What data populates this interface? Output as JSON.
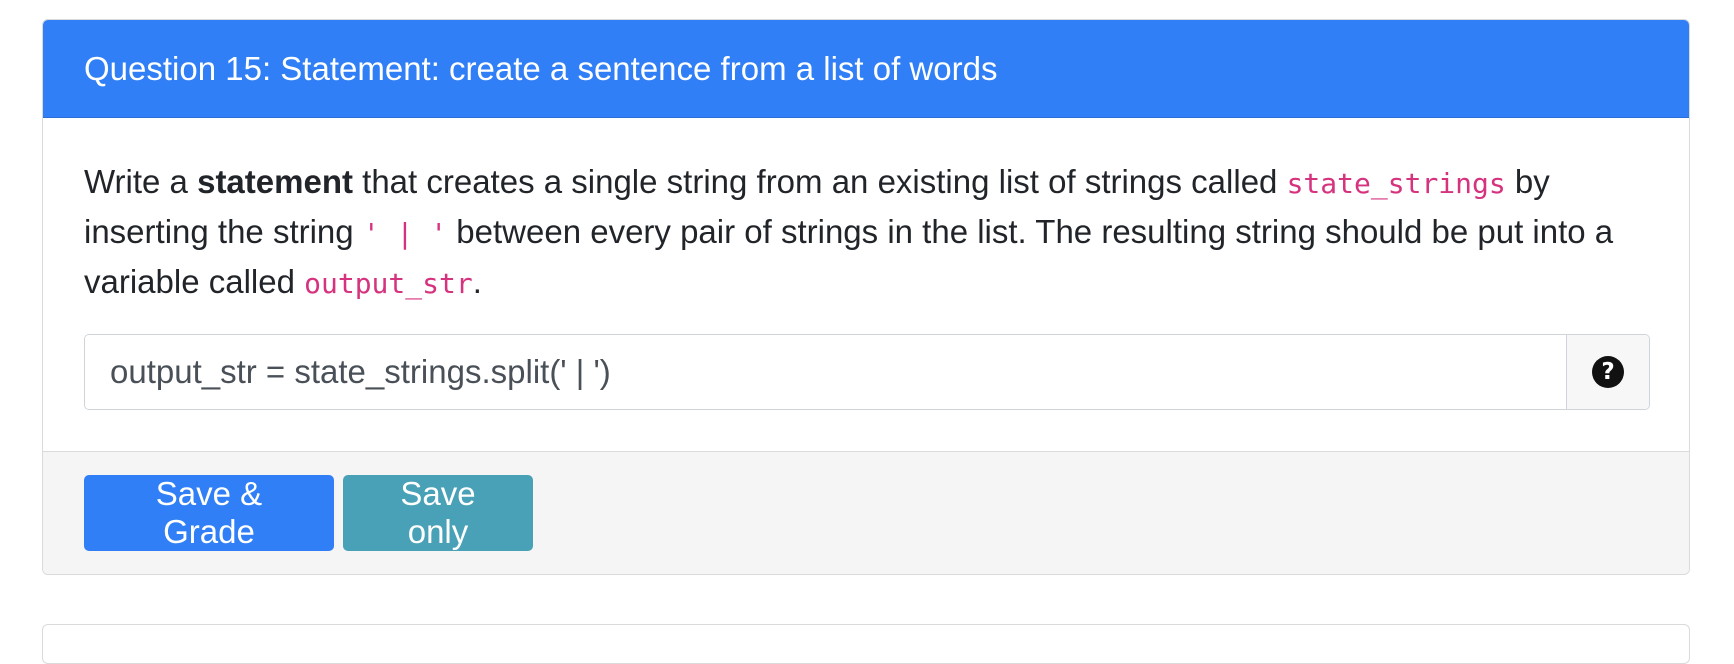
{
  "question": {
    "header": "Question 15: Statement: create a sentence from a list of words",
    "prompt": {
      "part1": "Write a ",
      "bold": "statement",
      "part2": " that creates a single string from an existing list of strings called ",
      "code1": "state_strings",
      "part3": " by inserting the string ",
      "code2": "' | '",
      "part4": " between every pair of strings in the list. The resulting string should be put into a variable called ",
      "code3": "output_str",
      "part5": "."
    },
    "answer_value": "output_str = state_strings.split(' | ')",
    "help_icon": "question-circle-icon"
  },
  "footer": {
    "save_grade_label": "Save & Grade",
    "save_only_label": "Save only"
  },
  "colors": {
    "header_bg": "#307ff6",
    "primary_button": "#307ff6",
    "info_button": "#48a1b6",
    "code_text": "#d6337f"
  }
}
